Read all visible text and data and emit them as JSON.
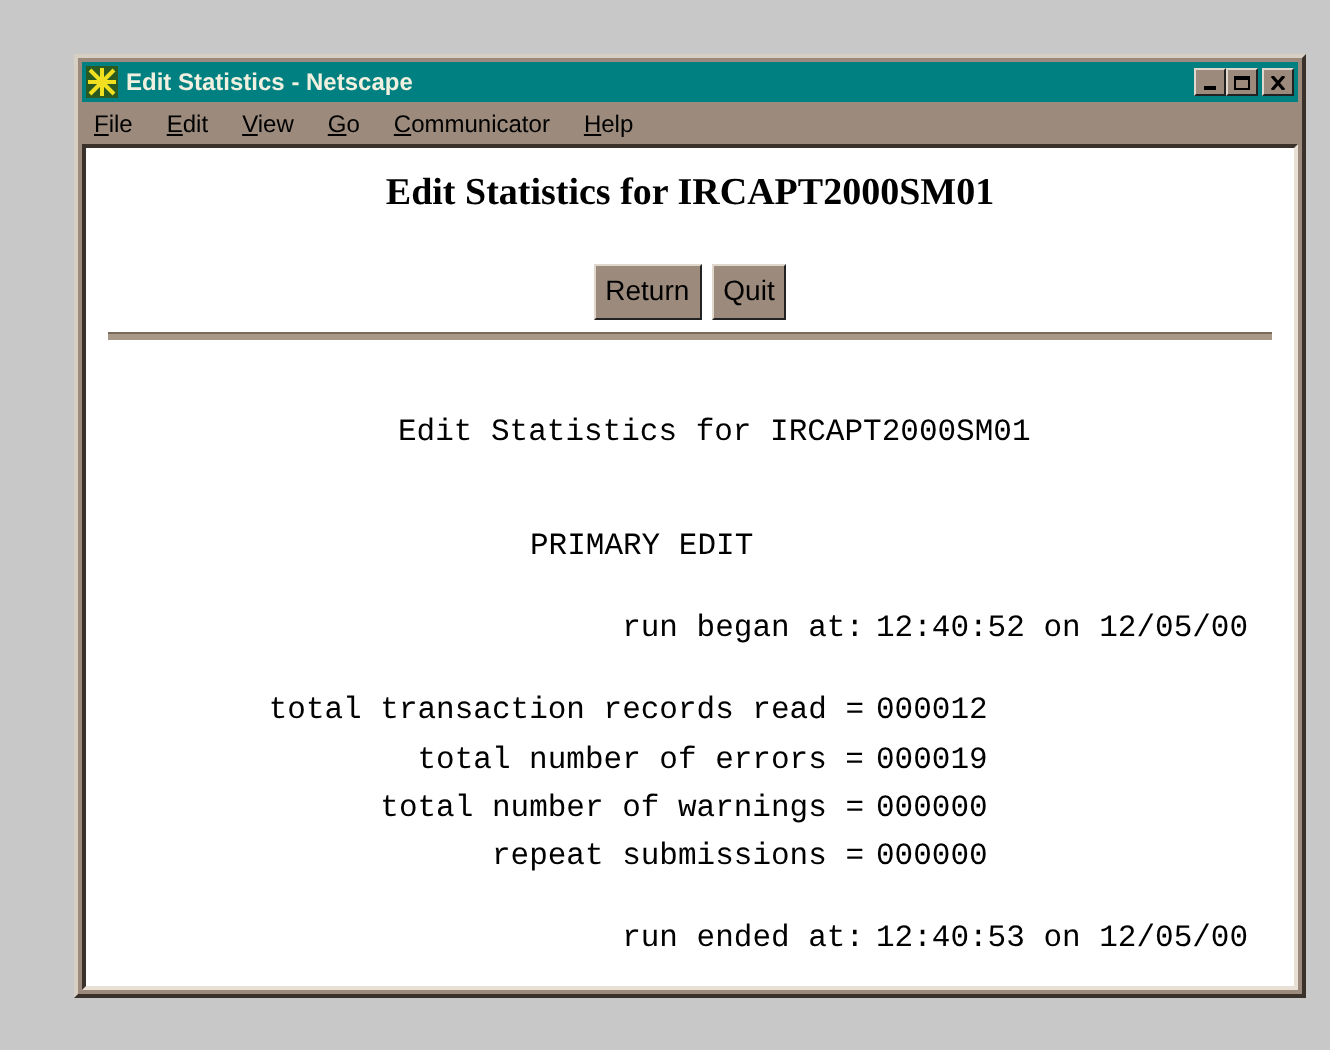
{
  "window": {
    "title": "Edit Statistics - Netscape"
  },
  "menu": [
    "File",
    "Edit",
    "View",
    "Go",
    "Communicator",
    "Help"
  ],
  "page": {
    "heading": "Edit Statistics for IRCAPT2000SM01",
    "buttons": [
      "Return",
      "Quit"
    ]
  },
  "report": {
    "heading": "Edit Statistics for IRCAPT2000SM01",
    "section": "PRIMARY EDIT",
    "run_began": {
      "label": "run began at:",
      "value": "12:40:52 on 12/05/00"
    },
    "stats": [
      {
        "label": "total transaction records read =",
        "value": "000012"
      },
      {
        "label": "total number of errors =",
        "value": "000019"
      },
      {
        "label": "total number of warnings =",
        "value": "000000"
      },
      {
        "label": "repeat submissions =",
        "value": "000000"
      }
    ],
    "run_ended": {
      "label": "run ended at:",
      "value": "12:40:53 on 12/05/00"
    }
  }
}
